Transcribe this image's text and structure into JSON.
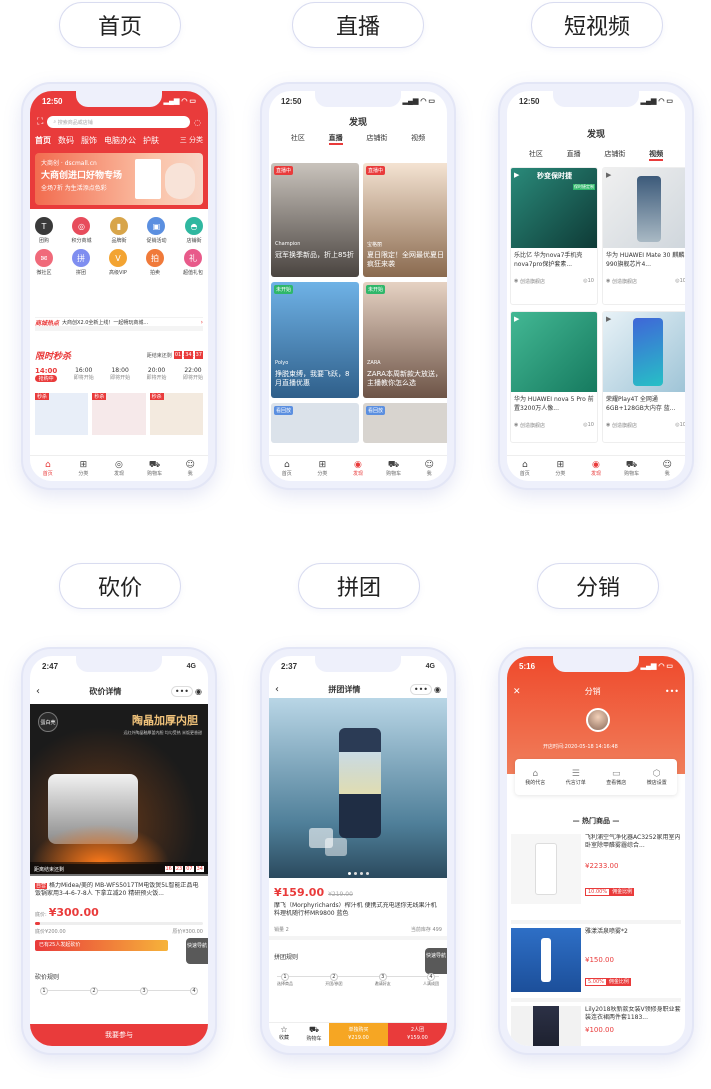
{
  "pills": [
    "首页",
    "直播",
    "短视频",
    "砍价",
    "拼团",
    "分销"
  ],
  "status": {
    "time1": "12:50",
    "time2": "2:47",
    "time3": "2:37",
    "time4": "5:16",
    "net": "4G",
    "signal": "▂▄▆ ◠ ▭"
  },
  "home": {
    "search_placeholder": "搜索商品或店铺",
    "nav": [
      "首页",
      "数码",
      "服饰",
      "电脑办公",
      "护肤"
    ],
    "nav_more": "三 分类",
    "banner_small": "大商创 · dscmall.cn",
    "banner_title": "大商创进口好物专场",
    "banner_sub": "全场7折 为生活添点色彩",
    "icons": [
      {
        "label": "团购",
        "icon": "shirt-icon",
        "color": "#3a3a3a"
      },
      {
        "label": "积分商城",
        "icon": "coin-icon",
        "color": "#e74c5c"
      },
      {
        "label": "品牌街",
        "icon": "bottle-icon",
        "color": "#d8a54a"
      },
      {
        "label": "促销活动",
        "icon": "box-icon",
        "color": "#5b8fe0"
      },
      {
        "label": "店铺街",
        "icon": "hat-icon",
        "color": "#2fb7a0"
      },
      {
        "label": "微社区",
        "icon": "chat-icon",
        "color": "#f06a7a"
      },
      {
        "label": "拼团",
        "icon": "group-icon",
        "color": "#7f8ef0"
      },
      {
        "label": "高级VIP",
        "icon": "vip-icon",
        "color": "#f3a432"
      },
      {
        "label": "拍卖",
        "icon": "auction-icon",
        "color": "#f07a3a"
      },
      {
        "label": "超值礼包",
        "icon": "gift-icon",
        "color": "#e85a8a"
      }
    ],
    "hot_tag": "商城热点",
    "hot_text": "大商创X2.0全新上线！一起畅玩商城...",
    "flash_title": "限时秒杀",
    "flash_end": "距结束还剩",
    "flash_timer": [
      "01",
      "34",
      "37"
    ],
    "flash_times": [
      {
        "t": "14:00",
        "s": "抢购中"
      },
      {
        "t": "16:00",
        "s": "即将开始"
      },
      {
        "t": "18:00",
        "s": "即将开始"
      },
      {
        "t": "20:00",
        "s": "即将开始"
      },
      {
        "t": "22:00",
        "s": "即将开始"
      }
    ],
    "seckill_tag": "秒杀",
    "tabs": [
      "首页",
      "分类",
      "发现",
      "购物车",
      "我"
    ]
  },
  "live": {
    "title": "发现",
    "tabs": [
      "社区",
      "直播",
      "店铺街",
      "视频"
    ],
    "items": [
      {
        "badge": "直播中",
        "text": "冠军换季新品，折上85折",
        "brand": "Champion"
      },
      {
        "badge": "直播中",
        "text": "夏日限定！全网最优夏日疯狂来袭",
        "brand": "宝格丽"
      },
      {
        "badge": "未开始",
        "text": "挣脱束缚，我要飞跃，8月直播优惠",
        "brand": "Polyo"
      },
      {
        "badge": "未开始",
        "text": "ZARA本周新款大放送，主播教你怎么选",
        "brand": "ZARA"
      },
      {
        "badge": "看回放",
        "text": "",
        "brand": ""
      },
      {
        "badge": "看回放",
        "text": "",
        "brand": ""
      }
    ],
    "tabs_bottom": [
      "首页",
      "分类",
      "发现",
      "购物车",
      "我"
    ]
  },
  "video": {
    "title": "发现",
    "tabs": [
      "社区",
      "直播",
      "店铺街",
      "视频"
    ],
    "overlay": "秒变保时捷",
    "overlay_badge": "保时捷定制",
    "items": [
      {
        "text": "乐比亿 华为nova7手机壳nova7pro保护套素...",
        "shop": "创造旗舰店",
        "views": "10"
      },
      {
        "text": "华为 HUAWEI Mate 30 麒麟990旗舰芯片4...",
        "shop": "创造旗舰店",
        "views": "10"
      },
      {
        "text": "华为 HUAWEI nova 5 Pro 前置3200万人像...",
        "shop": "创造旗舰店",
        "views": "10"
      },
      {
        "text": "荣耀Play4T 全网通6GB+128GB大内存 蓝...",
        "shop": "创造旗舰店",
        "views": "10"
      }
    ],
    "tabs_bottom": [
      "首页",
      "分类",
      "发现",
      "购物车",
      "我"
    ]
  },
  "bargain": {
    "title": "砍价详情",
    "hero_top": "陶晶加厚内胆",
    "hero_sub": "远红外陶晶釉厚釜内胆 均匀受热 米饭更香甜",
    "hero_badge": "蛋白壳",
    "countdown_label": "距离结束还剩",
    "timer": [
      "16",
      "23",
      "07",
      "34"
    ],
    "tag": "自营",
    "product": "格力Midea/美的 MB-WFS5017TM电饭煲5L智能正品电饭锅家用3-4-6-7-8人 下拿立减20 精研预火饭...",
    "price_label": "底价:",
    "price": "¥300.00",
    "low": "底价¥200.00",
    "high": "原价¥300.00",
    "joined": "已有25人发起砍价",
    "nav_btn": "快速导航",
    "rules": "砍价规则",
    "steps": [
      "1",
      "2",
      "3",
      "4"
    ],
    "cta": "我要参与"
  },
  "group": {
    "title": "拼团详情",
    "price": "¥159.00",
    "old": "¥219.00",
    "product": "摩飞（Morphyrichards）榨汁机 便携式充电迷你无线果汁机料理机随行杯MR9800 蓝色",
    "sold": "销量 2",
    "stock": "当前库存 499",
    "rules": "拼团规则",
    "steps": [
      "1",
      "2",
      "3",
      "4"
    ],
    "step_labels": [
      "选择商品",
      "开团/参团",
      "邀请好友",
      "人满成团"
    ],
    "nav_btn": "快速导航",
    "bb1": "收藏",
    "bb2": "购物车",
    "single_label": "单独购买",
    "single_price": "¥219.00",
    "group_label": "2人团",
    "group_price": "¥159.00"
  },
  "dist": {
    "title": "分销",
    "open_time": "开店时间:2020-05-18 14:16:48",
    "menu": [
      "我的代言",
      "代言订单",
      "查看微店",
      "微店设置"
    ],
    "section": "热门商品",
    "items": [
      {
        "name": "飞利浦空气净化器AC3252家用室内卧室除甲醛雾霾综合...",
        "price": "¥2233.00",
        "pct": "10.00%",
        "comm": "佣金比例"
      },
      {
        "name": "雅漾活泉喷雾*2",
        "price": "¥150.00",
        "pct": "5.00%",
        "comm": "佣金比例"
      },
      {
        "name": "Lily2018秋新款女装V领修身职业套装连衣裙两件套1183...",
        "price": "¥100.00",
        "pct": "",
        "comm": ""
      }
    ]
  }
}
